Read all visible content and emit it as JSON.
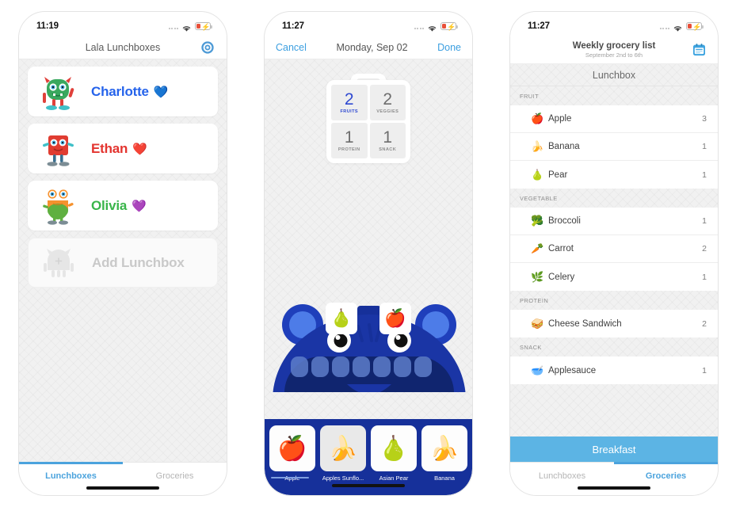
{
  "screens": [
    {
      "status": {
        "time": "11:19",
        "wifi_icon": "wifi-icon",
        "battery_icon": "battery-low-charging-icon"
      },
      "nav": {
        "title": "Lala Lunchboxes",
        "settings_icon": "gear-icon"
      },
      "lunchboxes": [
        {
          "name": "Charlotte",
          "heart": "💙",
          "color": "#2563eb",
          "avatar_icon": "green-monster-avatar"
        },
        {
          "name": "Ethan",
          "heart": "❤️",
          "color": "#e3342f",
          "avatar_icon": "red-monster-avatar"
        },
        {
          "name": "Olivia",
          "heart": "💜",
          "color": "#39b54a",
          "avatar_icon": "orange-monster-avatar"
        }
      ],
      "add_label": "Add Lunchbox",
      "tabs": [
        {
          "label": "Lunchboxes",
          "active": true
        },
        {
          "label": "Groceries",
          "active": false
        }
      ]
    },
    {
      "status": {
        "time": "11:27",
        "wifi_icon": "wifi-icon",
        "battery_icon": "battery-low-charging-icon"
      },
      "nav": {
        "cancel": "Cancel",
        "title": "Monday, Sep 02",
        "done": "Done"
      },
      "lunchbox_counts": [
        {
          "count": "2",
          "label": "FRUITS",
          "highlight": true
        },
        {
          "count": "2",
          "label": "VEGGIES",
          "highlight": false
        },
        {
          "count": "1",
          "label": "PROTEIN",
          "highlight": false
        },
        {
          "count": "1",
          "label": "SNACK",
          "highlight": false
        }
      ],
      "mouth_items": [
        {
          "name": "pear-card",
          "emoji": "🍐"
        },
        {
          "name": "apple-card",
          "emoji": "🍎"
        }
      ],
      "food_picker": [
        {
          "label": "Apple",
          "emoji": "🍎",
          "tinted": false
        },
        {
          "label": "Apples Sunflo...",
          "emoji": "🍌",
          "tinted": true
        },
        {
          "label": "Asian Pear",
          "emoji": "🍐",
          "tinted": false
        },
        {
          "label": "Banana",
          "emoji": "🍌",
          "tinted": false
        }
      ]
    },
    {
      "status": {
        "time": "11:27",
        "wifi_icon": "wifi-icon",
        "battery_icon": "battery-low-charging-icon"
      },
      "nav": {
        "title": "Weekly grocery list",
        "subtitle": "September 2nd to 6th",
        "calendar_icon": "calendar-icon"
      },
      "segment": "Lunchbox",
      "sections": [
        {
          "title": "FRUIT",
          "items": [
            {
              "emoji": "🍎",
              "name": "Apple",
              "qty": "3"
            },
            {
              "emoji": "🍌",
              "name": "Banana",
              "qty": "1"
            },
            {
              "emoji": "🍐",
              "name": "Pear",
              "qty": "1"
            }
          ]
        },
        {
          "title": "VEGETABLE",
          "items": [
            {
              "emoji": "🥦",
              "name": "Broccoli",
              "qty": "1"
            },
            {
              "emoji": "🥕",
              "name": "Carrot",
              "qty": "2"
            },
            {
              "emoji": "🌿",
              "name": "Celery",
              "qty": "1"
            }
          ]
        },
        {
          "title": "PROTEIN",
          "items": [
            {
              "emoji": "🥪",
              "name": "Cheese Sandwich",
              "qty": "2"
            }
          ]
        },
        {
          "title": "SNACK",
          "items": [
            {
              "emoji": "🥣",
              "name": "Applesauce",
              "qty": "1"
            }
          ]
        }
      ],
      "breakfast_bar": "Breakfast",
      "tabs": [
        {
          "label": "Lunchboxes",
          "active": false
        },
        {
          "label": "Groceries",
          "active": true
        }
      ]
    }
  ],
  "colors": {
    "accent_blue": "#4ba3dd",
    "nav_blue": "#3c9fe0",
    "monster_blue": "#16309a",
    "breakfast_blue": "#5cb4e4"
  }
}
